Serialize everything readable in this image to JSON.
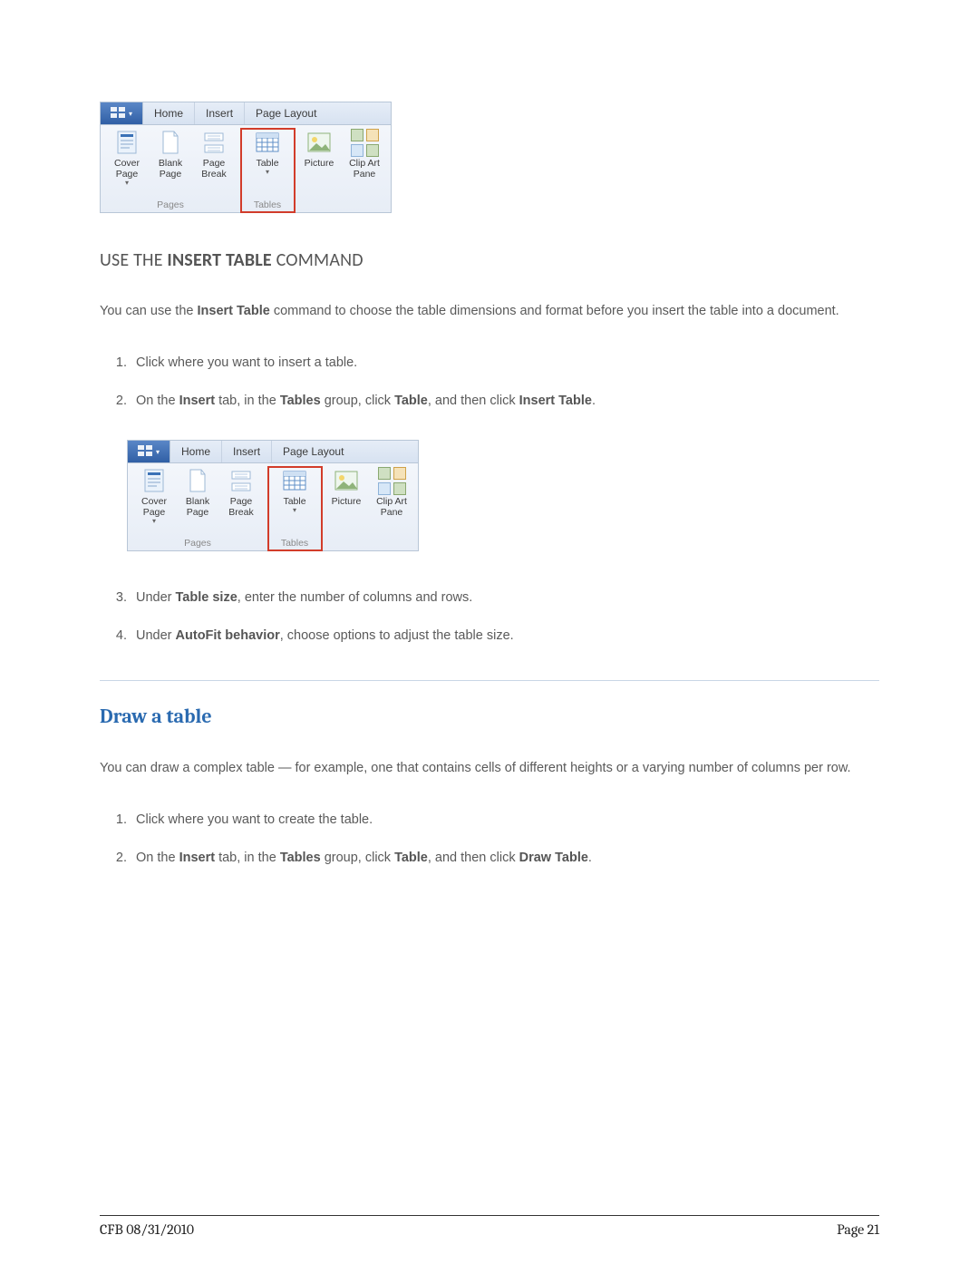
{
  "ribbon": {
    "tabs": {
      "home": "Home",
      "insert": "Insert",
      "page_layout": "Page Layout"
    },
    "groups": {
      "pages": {
        "label": "Pages",
        "cover_page": "Cover\nPage",
        "blank_page": "Blank\nPage",
        "page_break": "Page\nBreak"
      },
      "tables": {
        "label": "Tables",
        "table": "Table"
      },
      "illustrations": {
        "picture": "Picture",
        "clip_art": "Clip Art\nPane"
      }
    }
  },
  "section1": {
    "heading_pre": "USE THE ",
    "heading_bold": "INSERT TABLE",
    "heading_post": " COMMAND",
    "intro_pre": "You can use the ",
    "intro_bold": "Insert Table",
    "intro_post": " command to choose the table dimensions and format before you insert the table into a document.",
    "steps": {
      "s1": "Click where you want to insert a table.",
      "s2_a": "On the ",
      "s2_b1": "Insert",
      "s2_c": " tab, in the ",
      "s2_b2": "Tables",
      "s2_d": " group, click ",
      "s2_b3": "Table",
      "s2_e": ", and then click ",
      "s2_b4": "Insert Table",
      "s2_f": ".",
      "s3_a": "Under ",
      "s3_b": "Table size",
      "s3_c": ", enter the number of columns and rows.",
      "s4_a": "Under ",
      "s4_b": "AutoFit behavior",
      "s4_c": ", choose options to adjust the table size."
    }
  },
  "section2": {
    "heading": "Draw a table",
    "intro": "You can draw a complex table — for example, one that contains cells of different heights or a varying number of columns per row.",
    "steps": {
      "s1": "Click where you want to create the table.",
      "s2_a": "On the ",
      "s2_b1": "Insert",
      "s2_c": " tab, in the ",
      "s2_b2": "Tables",
      "s2_d": " group, click ",
      "s2_b3": "Table",
      "s2_e": ", and then click ",
      "s2_b4": "Draw Table",
      "s2_f": "."
    }
  },
  "footer": {
    "left": "CFB 08/31/2010",
    "right": "Page 21"
  }
}
